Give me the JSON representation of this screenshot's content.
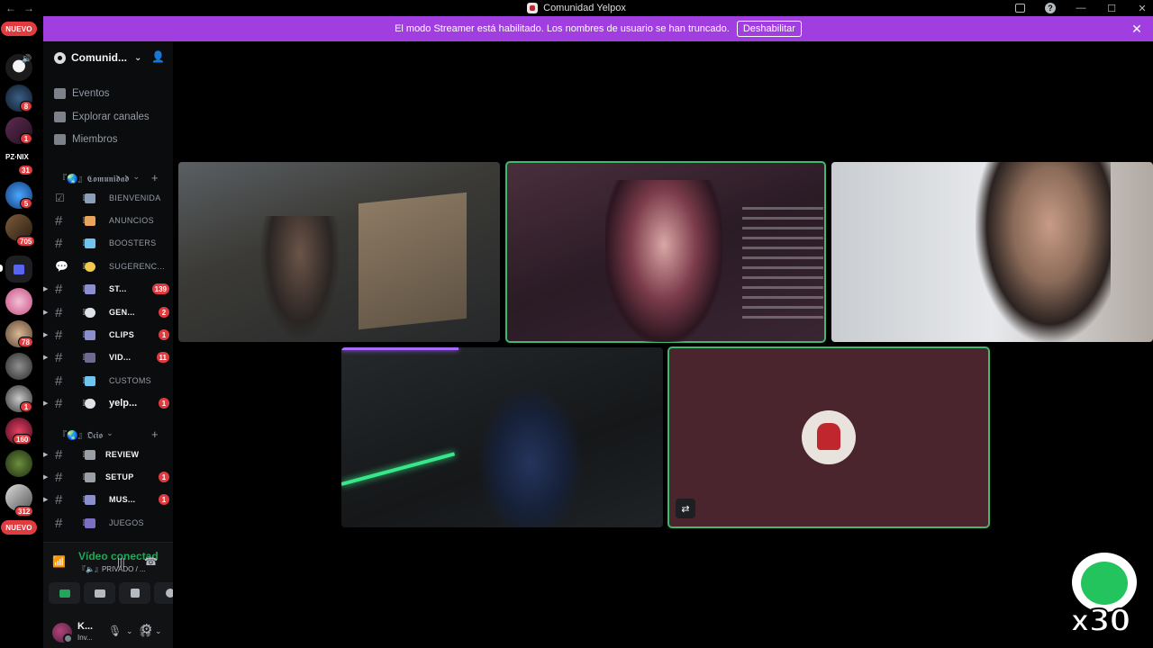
{
  "window": {
    "title": "Comunidad Yelpox",
    "back_glyph": "←",
    "forward_glyph": "→",
    "controls": [
      "inbox-icon",
      "help-icon",
      "minimize",
      "maximize",
      "close"
    ]
  },
  "banner": {
    "message": "El modo Streamer está habilitado. Los nombres de usuario se han truncado.",
    "button_label": "Deshabilitar",
    "close_glyph": "✕",
    "color": "#a13ee0"
  },
  "rail": {
    "new_label_top": "NUEVO",
    "new_label_bottom": "NUEVO",
    "servers": [
      {
        "badge": "8"
      },
      {
        "badge": "1"
      },
      {
        "badge": "31"
      },
      {
        "badge": "5"
      },
      {
        "badge": "705"
      },
      {
        "badge": ""
      },
      {
        "badge": ""
      },
      {
        "badge": "78"
      },
      {
        "badge": ""
      },
      {
        "badge": "1"
      },
      {
        "badge": "160"
      },
      {
        "badge": ""
      },
      {
        "badge": "312"
      }
    ]
  },
  "guild": {
    "name": "Comunid...",
    "nav": [
      {
        "label": "Eventos",
        "icon": "calendar-icon"
      },
      {
        "label": "Explorar canales",
        "icon": "browse-channels-icon"
      },
      {
        "label": "Miembros",
        "icon": "members-icon"
      }
    ],
    "categories": [
      {
        "label": "『🌏』𝕮𝖔𝖒𝖚𝖓𝖎𝖉𝖆𝖉",
        "channels": [
          {
            "name": "BIENVENIDA",
            "badge": "",
            "unread": false,
            "type": "rules"
          },
          {
            "name": "ANUNCIOS",
            "badge": "",
            "unread": false,
            "type": "text"
          },
          {
            "name": "BOOSTERS",
            "badge": "",
            "unread": false,
            "type": "text"
          },
          {
            "name": "SUGERENC...",
            "badge": "",
            "unread": false,
            "type": "forum"
          },
          {
            "name": "ST...",
            "badge": "139",
            "unread": true,
            "type": "text"
          },
          {
            "name": "GEN...",
            "badge": "2",
            "unread": true,
            "type": "text"
          },
          {
            "name": "CLIPS",
            "badge": "1",
            "unread": true,
            "type": "text"
          },
          {
            "name": "VID...",
            "badge": "11",
            "unread": true,
            "type": "text"
          },
          {
            "name": "CUSTOMS",
            "badge": "",
            "unread": false,
            "type": "text"
          },
          {
            "name": "yelp...",
            "badge": "1",
            "unread": true,
            "type": "text"
          }
        ]
      },
      {
        "label": "『🌏』𝕺𝖈𝖎𝖔",
        "channels": [
          {
            "name": "REVIEW",
            "badge": "",
            "unread": true,
            "type": "text"
          },
          {
            "name": "SETUP",
            "badge": "1",
            "unread": true,
            "type": "text"
          },
          {
            "name": "MUS...",
            "badge": "1",
            "unread": true,
            "type": "text"
          },
          {
            "name": "JUEGOS",
            "badge": "",
            "unread": false,
            "type": "text"
          }
        ]
      }
    ]
  },
  "voice": {
    "status": "Vídeo conectad",
    "channel": "『🔈』PRIVADO / ..."
  },
  "user": {
    "name": "K...",
    "status": "Inv..."
  },
  "sticker": {
    "text": "x30"
  },
  "colors": {
    "speaking_outline": "#3fb96b",
    "badge_red": "#e03b3f",
    "connected_green": "#23a55a"
  }
}
